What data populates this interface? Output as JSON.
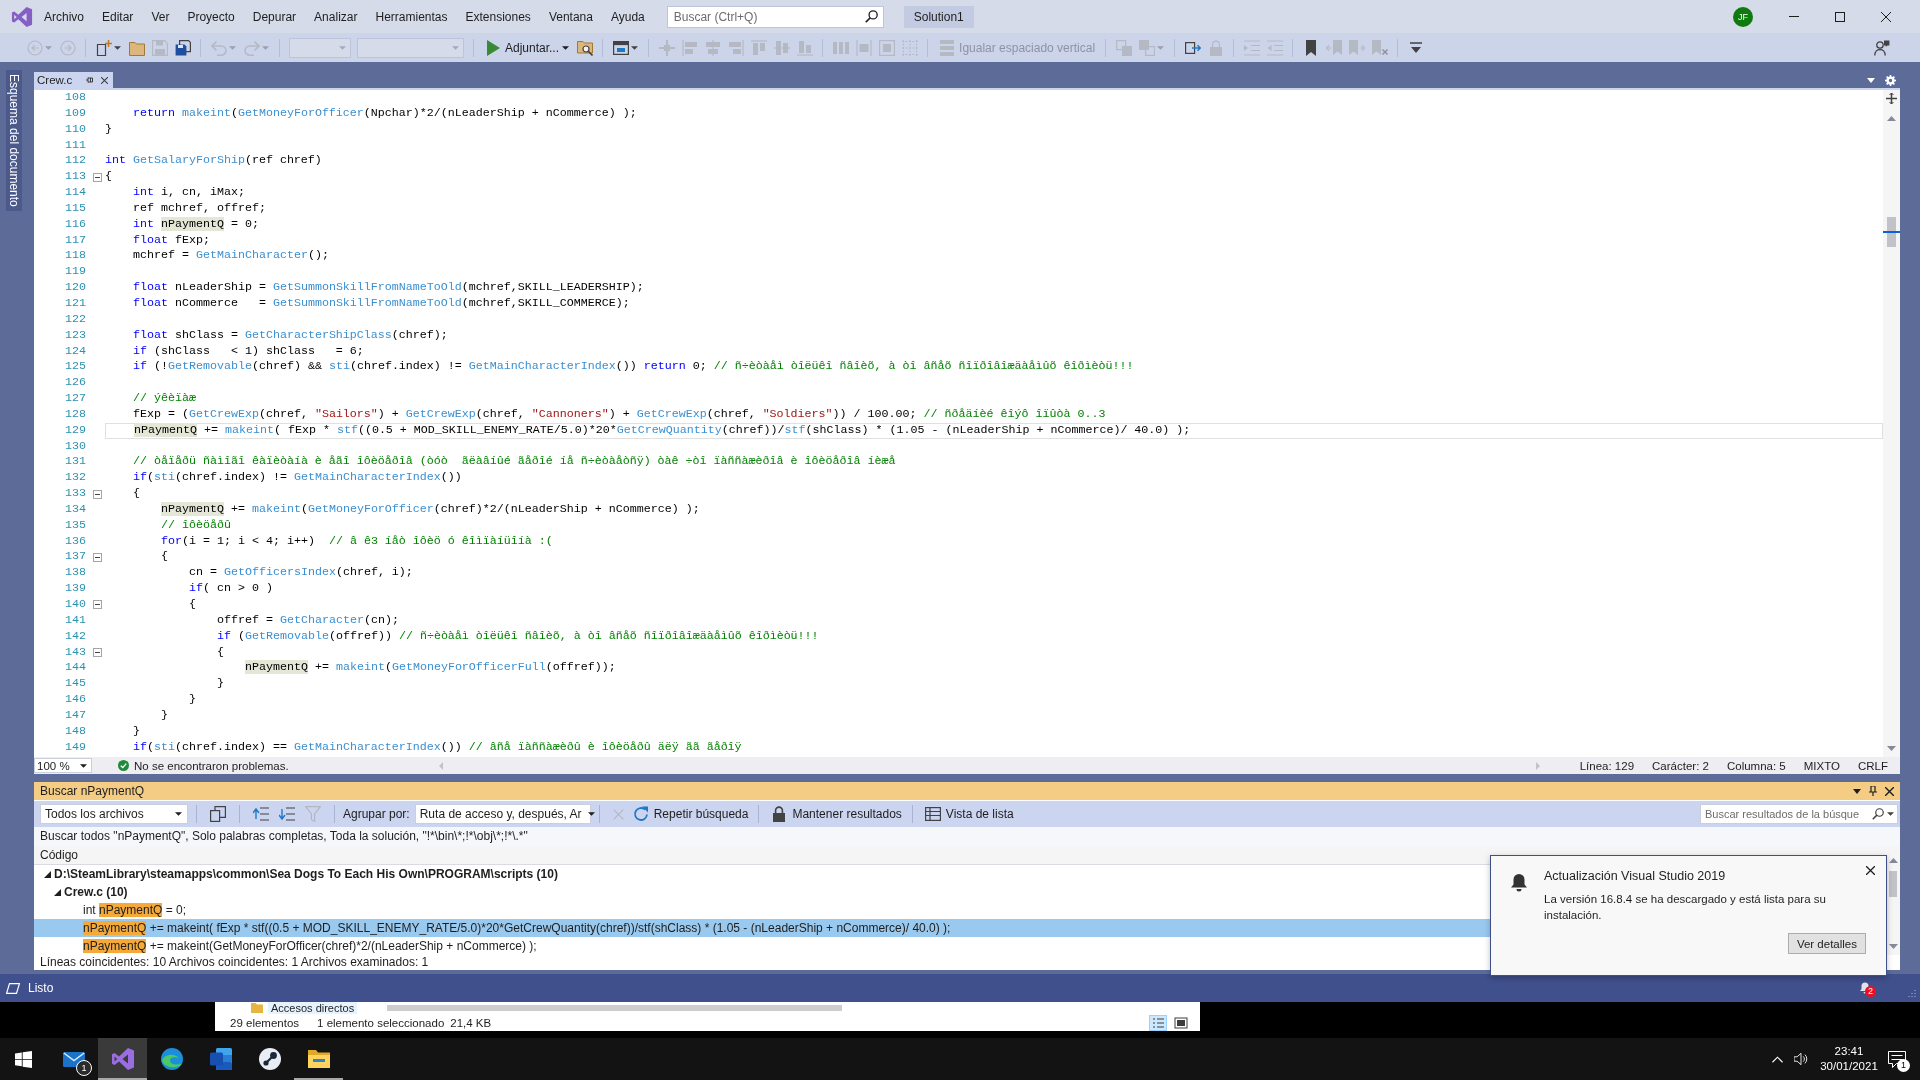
{
  "window": {
    "title": "Solution1",
    "account": "JF"
  },
  "menu": [
    "Archivo",
    "Editar",
    "Ver",
    "Proyecto",
    "Depurar",
    "Analizar",
    "Herramientas",
    "Extensiones",
    "Ventana",
    "Ayuda"
  ],
  "search": {
    "placeholder": "Buscar (Ctrl+Q)"
  },
  "toolbar": [
    [
      {
        "kind": "back",
        "disabled": true
      },
      {
        "kind": "forward",
        "disabled": true
      }
    ],
    [
      {
        "kind": "newitem",
        "disabled": false
      },
      {
        "kind": "open",
        "disabled": false
      },
      {
        "kind": "save",
        "disabled": true
      },
      {
        "kind": "saveall",
        "disabled": false
      }
    ],
    [
      {
        "kind": "undo",
        "disabled": true
      },
      {
        "kind": "redo",
        "disabled": true
      }
    ],
    [
      {
        "kind": "combo",
        "disabled": true
      },
      {
        "kind": "combowide",
        "disabled": true
      }
    ],
    [
      {
        "kind": "run",
        "label": "Adjuntar...",
        "disabled": false
      },
      {
        "kind": "findfiles",
        "disabled": false
      }
    ],
    [
      {
        "kind": "window",
        "disabled": false
      }
    ],
    [
      {
        "kind": "guides",
        "disabled": true
      },
      {
        "kind": "alignleft",
        "disabled": true
      },
      {
        "kind": "aligncenter",
        "disabled": true
      },
      {
        "kind": "alignright",
        "disabled": true
      },
      {
        "kind": "aligntop",
        "disabled": true
      },
      {
        "kind": "alignmiddle",
        "disabled": true
      },
      {
        "kind": "alignbottom",
        "disabled": true
      }
    ],
    [
      {
        "kind": "hspace",
        "disabled": true
      },
      {
        "kind": "vsize",
        "disabled": true
      },
      {
        "kind": "sizeboth",
        "disabled": true
      },
      {
        "kind": "grid",
        "disabled": true
      }
    ],
    [
      {
        "kind": "vspace",
        "label": "Igualar espaciado vertical",
        "disabled": true
      }
    ],
    [
      {
        "kind": "front",
        "disabled": true
      },
      {
        "kind": "backward",
        "disabled": true
      }
    ],
    [
      {
        "kind": "taborder",
        "disabled": false
      },
      {
        "kind": "lockctl",
        "disabled": true
      }
    ],
    [
      {
        "kind": "indent",
        "disabled": true
      },
      {
        "kind": "outdent",
        "disabled": true
      }
    ],
    [
      {
        "kind": "bookmark",
        "disabled": false
      },
      {
        "kind": "bmprev",
        "disabled": true
      },
      {
        "kind": "bmnext",
        "disabled": true
      },
      {
        "kind": "bmclear",
        "disabled": true
      }
    ],
    [
      {
        "kind": "overflow",
        "disabled": false
      }
    ]
  ],
  "side_tab": "Esquema del documento",
  "document_tabs": [
    {
      "label": "Crew.c",
      "selected": true
    }
  ],
  "editor": {
    "lines": [
      {
        "n": "108",
        "fold": false,
        "current": false
      },
      {
        "n": "109",
        "fold": false,
        "current": false,
        "tokens": [
          {
            "kind": "keyword",
            "text": "    return "
          },
          {
            "kind": "function",
            "text": "makeint"
          },
          {
            "kind": "text",
            "text": "("
          },
          {
            "kind": "function",
            "text": "GetMoneyForOfficer"
          },
          {
            "kind": "text",
            "text": "(Npchar)*2/(nLeaderShip + nCommerce) );"
          }
        ]
      },
      {
        "n": "110",
        "fold": false,
        "current": false,
        "tokens": [
          {
            "kind": "text",
            "text": "}"
          }
        ]
      },
      {
        "n": "111",
        "fold": false,
        "current": false
      },
      {
        "n": "112",
        "fold": false,
        "current": false,
        "tokens": [
          {
            "kind": "keyword",
            "text": "int "
          },
          {
            "kind": "function",
            "text": "GetSalaryForShip"
          },
          {
            "kind": "text",
            "text": "(ref chref)"
          }
        ]
      },
      {
        "n": "113",
        "fold": true,
        "current": false,
        "tokens": [
          {
            "kind": "text",
            "text": "{"
          }
        ]
      },
      {
        "n": "114",
        "fold": false,
        "current": false,
        "tokens": [
          {
            "kind": "keyword",
            "text": "    int"
          },
          {
            "kind": "text",
            "text": " i, cn, iMax;"
          }
        ]
      },
      {
        "n": "115",
        "fold": false,
        "current": false,
        "tokens": [
          {
            "kind": "text",
            "text": "    ref mchref, offref;"
          }
        ]
      },
      {
        "n": "116",
        "fold": false,
        "current": false,
        "tokens": [
          {
            "kind": "keyword",
            "text": "    int "
          },
          {
            "kind": "reference",
            "text": "nPaymentQ"
          },
          {
            "kind": "text",
            "text": " = 0;"
          }
        ]
      },
      {
        "n": "117",
        "fold": false,
        "current": false,
        "tokens": [
          {
            "kind": "keyword",
            "text": "    float"
          },
          {
            "kind": "text",
            "text": " fExp;"
          }
        ]
      },
      {
        "n": "118",
        "fold": false,
        "current": false,
        "tokens": [
          {
            "kind": "text",
            "text": "    mchref = "
          },
          {
            "kind": "function",
            "text": "GetMainCharacter"
          },
          {
            "kind": "text",
            "text": "();"
          }
        ]
      },
      {
        "n": "119",
        "fold": false,
        "current": false
      },
      {
        "n": "120",
        "fold": false,
        "current": false,
        "tokens": [
          {
            "kind": "keyword",
            "text": "    float"
          },
          {
            "kind": "text",
            "text": " nLeaderShip = "
          },
          {
            "kind": "function",
            "text": "GetSummonSkillFromNameToOld"
          },
          {
            "kind": "text",
            "text": "(mchref,SKILL_LEADERSHIP);"
          }
        ]
      },
      {
        "n": "121",
        "fold": false,
        "current": false,
        "tokens": [
          {
            "kind": "keyword",
            "text": "    float"
          },
          {
            "kind": "text",
            "text": " nCommerce   = "
          },
          {
            "kind": "function",
            "text": "GetSummonSkillFromNameToOld"
          },
          {
            "kind": "text",
            "text": "(mchref,SKILL_COMMERCE);"
          }
        ]
      },
      {
        "n": "122",
        "fold": false,
        "current": false
      },
      {
        "n": "123",
        "fold": false,
        "current": false,
        "tokens": [
          {
            "kind": "keyword",
            "text": "    float"
          },
          {
            "kind": "text",
            "text": " shClass = "
          },
          {
            "kind": "function",
            "text": "GetCharacterShipClass"
          },
          {
            "kind": "text",
            "text": "(chref);"
          }
        ]
      },
      {
        "n": "124",
        "fold": false,
        "current": false,
        "tokens": [
          {
            "kind": "keyword",
            "text": "    if"
          },
          {
            "kind": "text",
            "text": " (shClass   < 1) shClass   = 6;"
          }
        ]
      },
      {
        "n": "125",
        "fold": false,
        "current": false,
        "tokens": [
          {
            "kind": "keyword",
            "text": "    if"
          },
          {
            "kind": "text",
            "text": " (!"
          },
          {
            "kind": "function",
            "text": "GetRemovable"
          },
          {
            "kind": "text",
            "text": "(chref) && "
          },
          {
            "kind": "function",
            "text": "sti"
          },
          {
            "kind": "text",
            "text": "(chref.index) != "
          },
          {
            "kind": "function",
            "text": "GetMainCharacterIndex"
          },
          {
            "kind": "text",
            "text": "()) "
          },
          {
            "kind": "keyword",
            "text": "return"
          },
          {
            "kind": "text",
            "text": " 0; "
          },
          {
            "kind": "comment",
            "text": "// ñ÷èòàåì òîëüêî ñâîèõ, à òî âñåõ ñîïðîâîæäàåìûõ êîðìèòü!!!"
          }
        ]
      },
      {
        "n": "126",
        "fold": false,
        "current": false
      },
      {
        "n": "127",
        "fold": false,
        "current": false,
        "tokens": [
          {
            "kind": "comment",
            "text": "    // ýêèïàæ"
          }
        ]
      },
      {
        "n": "128",
        "fold": false,
        "current": false,
        "tokens": [
          {
            "kind": "text",
            "text": "    fExp = ("
          },
          {
            "kind": "function",
            "text": "GetCrewExp"
          },
          {
            "kind": "text",
            "text": "(chref, "
          },
          {
            "kind": "string",
            "text": "\"Sailors\""
          },
          {
            "kind": "text",
            "text": ") + "
          },
          {
            "kind": "function",
            "text": "GetCrewExp"
          },
          {
            "kind": "text",
            "text": "(chref, "
          },
          {
            "kind": "string",
            "text": "\"Cannoners\""
          },
          {
            "kind": "text",
            "text": ") + "
          },
          {
            "kind": "function",
            "text": "GetCrewExp"
          },
          {
            "kind": "text",
            "text": "(chref, "
          },
          {
            "kind": "string",
            "text": "\"Soldiers\""
          },
          {
            "kind": "text",
            "text": ")) / 100.00; "
          },
          {
            "kind": "comment",
            "text": "// ñðåäíèé êîýô îïûòà 0..3"
          }
        ]
      },
      {
        "n": "129",
        "fold": false,
        "current": true,
        "tokens": [
          {
            "kind": "reference",
            "text": "    nPaymentQ"
          },
          {
            "kind": "text",
            "text": " += "
          },
          {
            "kind": "function",
            "text": "makeint"
          },
          {
            "kind": "text",
            "text": "( fExp * "
          },
          {
            "kind": "function",
            "text": "stf"
          },
          {
            "kind": "text",
            "text": "((0.5 + MOD_SKILL_ENEMY_RATE/5.0)*20*"
          },
          {
            "kind": "function",
            "text": "GetCrewQuantity"
          },
          {
            "kind": "text",
            "text": "(chref))/"
          },
          {
            "kind": "function",
            "text": "stf"
          },
          {
            "kind": "text",
            "text": "(shClass) * (1.05 - (nLeaderShip + nCommerce)/ 40.0) );"
          }
        ]
      },
      {
        "n": "130",
        "fold": false,
        "current": false
      },
      {
        "n": "131",
        "fold": false,
        "current": false,
        "tokens": [
          {
            "kind": "comment",
            "text": "    // òåïåðü ñàìîãî êàïèòàíà è åãî îôèöåðîâ (òóò  ãëàâíûé ãåðîé íå ñ÷èòàåòñÿ) òàê ÷òî ïàññàæèðîâ è îôèöåðîâ íèæå"
          }
        ]
      },
      {
        "n": "132",
        "fold": false,
        "current": false,
        "tokens": [
          {
            "kind": "keyword",
            "text": "    if"
          },
          {
            "kind": "text",
            "text": "("
          },
          {
            "kind": "function",
            "text": "sti"
          },
          {
            "kind": "text",
            "text": "(chref.index) != "
          },
          {
            "kind": "function",
            "text": "GetMainCharacterIndex"
          },
          {
            "kind": "text",
            "text": "())"
          }
        ]
      },
      {
        "n": "133",
        "fold": true,
        "current": false,
        "tokens": [
          {
            "kind": "text",
            "text": "    {"
          }
        ]
      },
      {
        "n": "134",
        "fold": false,
        "current": false,
        "tokens": [
          {
            "kind": "reference",
            "text": "        nPaymentQ"
          },
          {
            "kind": "text",
            "text": " += "
          },
          {
            "kind": "function",
            "text": "makeint"
          },
          {
            "kind": "text",
            "text": "("
          },
          {
            "kind": "function",
            "text": "GetMoneyForOfficer"
          },
          {
            "kind": "text",
            "text": "(chref)*2/(nLeaderShip + nCommerce) );"
          }
        ]
      },
      {
        "n": "135",
        "fold": false,
        "current": false,
        "tokens": [
          {
            "kind": "comment",
            "text": "        // îôèöåðû"
          }
        ]
      },
      {
        "n": "136",
        "fold": false,
        "current": false,
        "tokens": [
          {
            "kind": "keyword",
            "text": "        for"
          },
          {
            "kind": "text",
            "text": "(i = 1; i < 4; i++)  "
          },
          {
            "kind": "comment",
            "text": "// â ê3 íåò îôèö ó êîìïàíüîíà :("
          }
        ]
      },
      {
        "n": "137",
        "fold": true,
        "current": false,
        "tokens": [
          {
            "kind": "text",
            "text": "        {"
          }
        ]
      },
      {
        "n": "138",
        "fold": false,
        "current": false,
        "tokens": [
          {
            "kind": "text",
            "text": "            cn = "
          },
          {
            "kind": "function",
            "text": "GetOfficersIndex"
          },
          {
            "kind": "text",
            "text": "(chref, i);"
          }
        ]
      },
      {
        "n": "139",
        "fold": false,
        "current": false,
        "tokens": [
          {
            "kind": "keyword",
            "text": "            if"
          },
          {
            "kind": "text",
            "text": "( cn > 0 )"
          }
        ]
      },
      {
        "n": "140",
        "fold": true,
        "current": false,
        "tokens": [
          {
            "kind": "text",
            "text": "            {"
          }
        ]
      },
      {
        "n": "141",
        "fold": false,
        "current": false,
        "tokens": [
          {
            "kind": "text",
            "text": "                offref = "
          },
          {
            "kind": "function",
            "text": "GetCharacter"
          },
          {
            "kind": "text",
            "text": "(cn);"
          }
        ]
      },
      {
        "n": "142",
        "fold": false,
        "current": false,
        "tokens": [
          {
            "kind": "keyword",
            "text": "                if"
          },
          {
            "kind": "text",
            "text": " ("
          },
          {
            "kind": "function",
            "text": "GetRemovable"
          },
          {
            "kind": "text",
            "text": "(offref)) "
          },
          {
            "kind": "comment",
            "text": "// ñ÷èòàåì òîëüêî ñâîèõ, à òî âñåõ ñîïðîâîæäàåìûõ êîðìèòü!!!"
          }
        ]
      },
      {
        "n": "143",
        "fold": true,
        "current": false,
        "tokens": [
          {
            "kind": "text",
            "text": "                {"
          }
        ]
      },
      {
        "n": "144",
        "fold": false,
        "current": false,
        "tokens": [
          {
            "kind": "reference",
            "text": "                    nPaymentQ"
          },
          {
            "kind": "text",
            "text": " += "
          },
          {
            "kind": "function",
            "text": "makeint"
          },
          {
            "kind": "text",
            "text": "("
          },
          {
            "kind": "function",
            "text": "GetMoneyForOfficerFull"
          },
          {
            "kind": "text",
            "text": "(offref));"
          }
        ]
      },
      {
        "n": "145",
        "fold": false,
        "current": false,
        "tokens": [
          {
            "kind": "text",
            "text": "                }"
          }
        ]
      },
      {
        "n": "146",
        "fold": false,
        "current": false,
        "tokens": [
          {
            "kind": "text",
            "text": "            }"
          }
        ]
      },
      {
        "n": "147",
        "fold": false,
        "current": false,
        "tokens": [
          {
            "kind": "text",
            "text": "        }"
          }
        ]
      },
      {
        "n": "148",
        "fold": false,
        "current": false,
        "tokens": [
          {
            "kind": "text",
            "text": "    }"
          }
        ]
      },
      {
        "n": "149",
        "fold": false,
        "current": false,
        "tokens": [
          {
            "kind": "keyword",
            "text": "    if"
          },
          {
            "kind": "text",
            "text": "("
          },
          {
            "kind": "function",
            "text": "sti"
          },
          {
            "kind": "text",
            "text": "(chref.index) == "
          },
          {
            "kind": "function",
            "text": "GetMainCharacterIndex"
          },
          {
            "kind": "text",
            "text": "()) "
          },
          {
            "kind": "comment",
            "text": "// âñå ïàññàæèðû è îôèöåðû äëÿ ãã ãåðîÿ"
          }
        ]
      }
    ]
  },
  "editor_status": {
    "zoom": "100 %",
    "issues": "No se encontraron problemas.",
    "fields": [
      "Línea: 129",
      "Carácter: 2",
      "Columna: 5",
      "MIXTO",
      "CRLF"
    ]
  },
  "find": {
    "title": "Buscar nPaymentQ",
    "scope": "Todos los archivos",
    "tools": [
      {
        "kind": "copy",
        "disabled": false
      },
      {
        "kind": "prev",
        "disabled": false
      },
      {
        "kind": "next",
        "disabled": false
      },
      {
        "kind": "filter",
        "disabled": true
      }
    ],
    "group_label": "Agrupar por:",
    "group_value": "Ruta de acceso y, después, Ar",
    "cancel": {
      "disabled": true
    },
    "actions": [
      {
        "kind": "repeat",
        "label": "Repetir búsqueda"
      },
      {
        "kind": "keep",
        "label": "Mantener resultados"
      },
      {
        "kind": "list",
        "label": "Vista de lista"
      }
    ],
    "filter": {
      "placeholder": "Buscar resultados de la búsque"
    },
    "description": "Buscar todos \"nPaymentQ\", Solo palabras completas, Toda la solución, \"!*\\bin\\*;!*\\obj\\*;!*\\.*\"",
    "column": "Código",
    "results": [
      {
        "text": "D:\\SteamLibrary\\steamapps\\common\\Sea Dogs To Each His Own\\PROGRAM\\scripts (10)",
        "expanded": true,
        "selected": false,
        "children": [
          {
            "text": "Crew.c (10)",
            "expanded": true,
            "selected": false,
            "children": [
              {
                "selected": false,
                "segments": [
                  {
                    "kind": "text",
                    "text": "int "
                  },
                  {
                    "kind": "match",
                    "text": "nPaymentQ"
                  },
                  {
                    "kind": "text",
                    "text": " = 0;"
                  }
                ]
              },
              {
                "selected": true,
                "segments": [
                  {
                    "kind": "match",
                    "text": "nPaymentQ"
                  },
                  {
                    "kind": "text",
                    "text": " += makeint( fExp * stf((0.5 + MOD_SKILL_ENEMY_RATE/5.0)*20*GetCrewQuantity(chref))/stf(shClass) * (1.05 - (nLeaderShip + nCommerce)/ 40.0) );"
                  }
                ]
              },
              {
                "selected": false,
                "segments": [
                  {
                    "kind": "match",
                    "text": "nPaymentQ"
                  },
                  {
                    "kind": "text",
                    "text": " += makeint(GetMoneyForOfficer(chref)*2/(nLeaderShip + nCommerce) );"
                  }
                ]
              }
            ]
          }
        ]
      }
    ],
    "summary": "Líneas coincidentes: 10 Archivos coincidentes: 1 Archivos examinados: 1"
  },
  "notification": {
    "title": "Actualización Visual Studio 2019",
    "body": "La versión 16.8.4 se ha descargado y está lista para su instalación.",
    "button": "Ver detalles"
  },
  "status_bar": {
    "text": "Listo",
    "notifications": "2"
  },
  "explorer": {
    "folder": "Accesos directos",
    "count": "29 elementos",
    "selection": "1 elemento seleccionado",
    "size": "21,4 KB"
  },
  "taskbar": {
    "apps": [
      {
        "kind": "mail",
        "badge": "1",
        "selected": false,
        "running": false
      },
      {
        "kind": "editor",
        "selected": true,
        "running": true
      },
      {
        "kind": "browser",
        "selected": false,
        "running": false
      },
      {
        "kind": "word",
        "selected": false,
        "running": false
      },
      {
        "kind": "steam",
        "selected": false,
        "running": false
      },
      {
        "kind": "files",
        "selected": false,
        "running": true
      }
    ],
    "time": "23:41",
    "date": "30/01/2021",
    "notifications": "1"
  }
}
